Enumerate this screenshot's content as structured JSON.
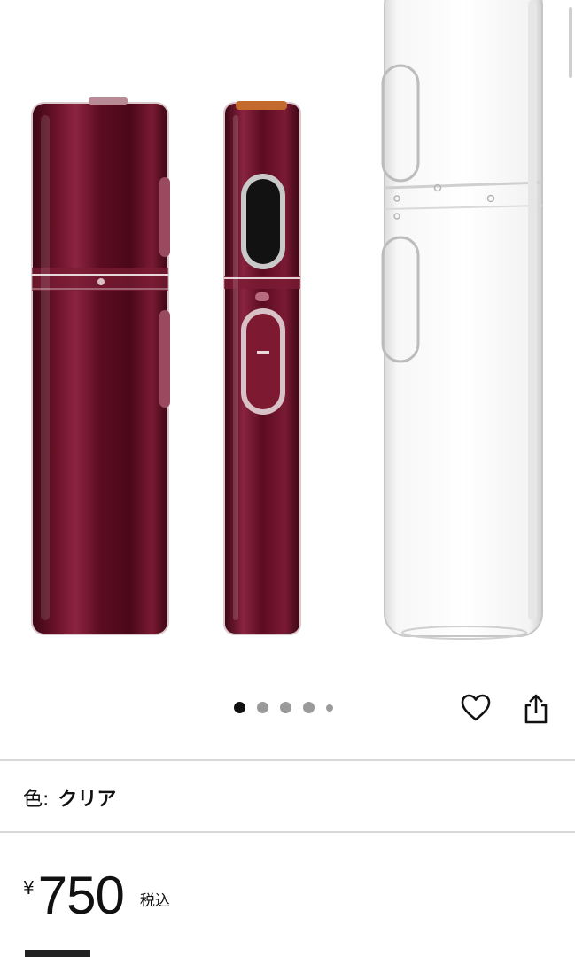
{
  "gallery": {
    "image_alt": "product-image",
    "dots": [
      {
        "active": true,
        "size": "normal"
      },
      {
        "active": false,
        "size": "normal"
      },
      {
        "active": false,
        "size": "normal"
      },
      {
        "active": false,
        "size": "normal"
      },
      {
        "active": false,
        "size": "small"
      }
    ]
  },
  "actions": {
    "favorite_icon": "heart-icon",
    "share_icon": "share-icon"
  },
  "variant": {
    "label": "色:",
    "value": "クリア"
  },
  "price": {
    "currency": "¥",
    "amount": "750",
    "tax_note": "税込"
  },
  "colors": {
    "burgundy": "#5b0f22",
    "accent": "#c46a2c"
  }
}
